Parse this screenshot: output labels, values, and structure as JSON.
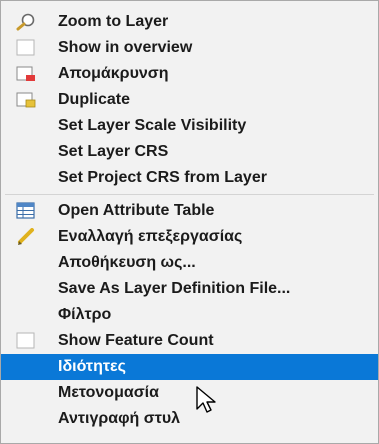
{
  "context_menu": {
    "items": [
      {
        "label": "Zoom to Layer",
        "icon": "zoom-to-layer-icon"
      },
      {
        "label": "Show in overview",
        "icon": "overview-checkbox-icon"
      },
      {
        "label": "Απομάκρυνση",
        "icon": "remove-layer-icon"
      },
      {
        "label": "Duplicate",
        "icon": "duplicate-layer-icon"
      },
      {
        "label": "Set Layer Scale Visibility"
      },
      {
        "label": "Set Layer CRS"
      },
      {
        "label": "Set Project CRS from Layer"
      },
      {
        "label": "Open Attribute Table",
        "icon": "attribute-table-icon"
      },
      {
        "label": "Εναλλαγή επεξεργασίας",
        "icon": "pencil-icon"
      },
      {
        "label": "Αποθήκευση ως..."
      },
      {
        "label": "Save As Layer Definition File..."
      },
      {
        "label": "Φίλτρο"
      },
      {
        "label": "Show Feature Count",
        "icon": "feature-count-checkbox-icon"
      },
      {
        "label": "Ιδιότητες",
        "selected": true
      },
      {
        "label": "Μετονομασία"
      },
      {
        "label": "Αντιγραφή στυλ"
      }
    ]
  },
  "colors": {
    "selected_background": "#0a78d7",
    "selected_text": "#ffffff",
    "menu_background": "#f2f2f2",
    "text": "#1b1b1b"
  },
  "cursor": {
    "icon": "mouse-pointer-icon"
  }
}
